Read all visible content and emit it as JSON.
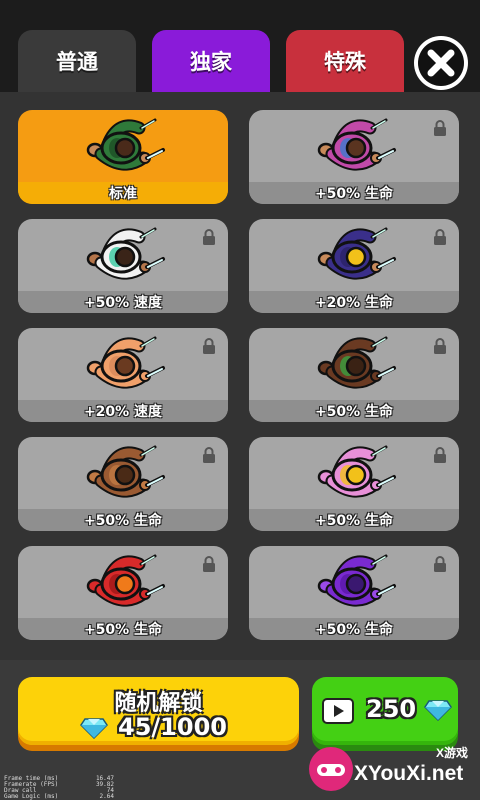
{
  "tabs": [
    {
      "label": "普通",
      "color": "#3a3a3a",
      "active": true
    },
    {
      "label": "独家",
      "color": "#8a1bd9"
    },
    {
      "label": "特殊",
      "color": "#c8303d"
    }
  ],
  "colors": {
    "selected": "#f59c12",
    "card": "#a6a6a6",
    "accent_yellow": "#fdd209",
    "accent_green": "#44d014"
  },
  "skins": [
    {
      "label": "标准",
      "selected": true,
      "locked": false,
      "body": "#2f7a3a",
      "accent": "#1d4f25",
      "head": "#4a2a1a",
      "skin": "#c88a5a"
    },
    {
      "label": "+50% 生命",
      "locked": true,
      "body": "#c14aa8",
      "accent": "#3b7bd0",
      "head": "#5a3420",
      "skin": "#c88a5a"
    },
    {
      "label": "+50% 速度",
      "locked": true,
      "body": "#f2f2f2",
      "accent": "#36c9a0",
      "head": "#3a2418",
      "skin": "#b5754a"
    },
    {
      "label": "+20% 生命",
      "locked": true,
      "body": "#3a2f8a",
      "accent": "#2b2266",
      "head": "#f2c11a",
      "skin": "#c88a5a"
    },
    {
      "label": "+20% 速度",
      "locked": true,
      "body": "#f0a06a",
      "accent": "#d8885a",
      "head": "#6a3a20",
      "skin": "#f0a06a"
    },
    {
      "label": "+50% 生命",
      "locked": true,
      "body": "#6a3a22",
      "accent": "#3aa040",
      "head": "#3a2214",
      "skin": "#6a3a22"
    },
    {
      "label": "+50% 生命",
      "locked": true,
      "body": "#9a5a32",
      "accent": "#c27a44",
      "head": "#4a2a16",
      "skin": "#c27a44"
    },
    {
      "label": "+50% 生命",
      "locked": true,
      "body": "#e890d8",
      "accent": "#f2c11a",
      "head": "#f2c11a",
      "skin": "#e890d8"
    },
    {
      "label": "+50% 生命",
      "locked": true,
      "body": "#d82a2a",
      "accent": "#a01818",
      "head": "#f07a1a",
      "skin": "#d82a2a"
    },
    {
      "label": "+50% 生命",
      "locked": true,
      "body": "#7a2ad0",
      "accent": "#5a18a8",
      "head": "#3a1870",
      "skin": "#9a4ae8"
    }
  ],
  "random_unlock": {
    "title": "随机解锁",
    "count": "45/1000"
  },
  "video_reward": {
    "count": "250"
  },
  "debug": [
    {
      "label": "Frame time (ms)",
      "value": "16.47"
    },
    {
      "label": "Framerate (FPS)",
      "value": "39.82"
    },
    {
      "label": "Draw call",
      "value": "74"
    },
    {
      "label": "Game Logic (ms)",
      "value": "2.64"
    }
  ],
  "watermark": {
    "small": "X游戏",
    "site": "XYouXi.net"
  }
}
